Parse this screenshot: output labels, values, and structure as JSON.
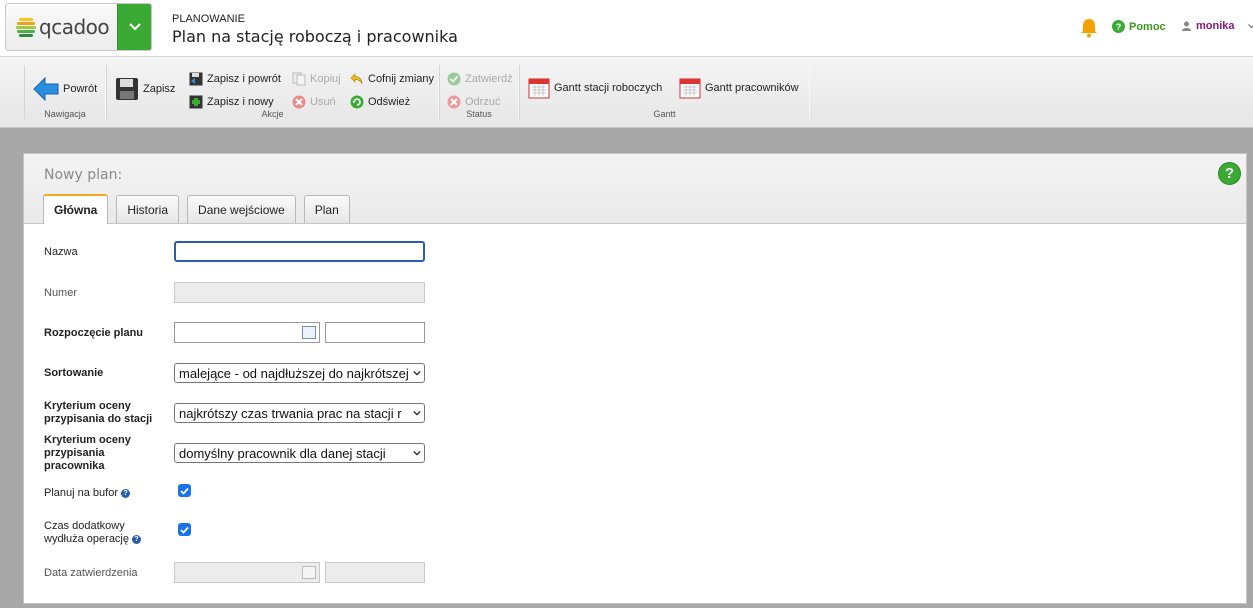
{
  "app": {
    "logo_text": "qcadoo",
    "section": "PLANOWANIE",
    "title": "Plan na stację roboczą i pracownika"
  },
  "topbar": {
    "help_label": "Pomoc",
    "user_name": "monika"
  },
  "toolbar": {
    "groups": {
      "nav": "Nawigacja",
      "actions": "Akcje",
      "status": "Status",
      "gantt": "Gantt"
    },
    "back": "Powrót",
    "save": "Zapisz",
    "save_back": "Zapisz i powrót",
    "save_new": "Zapisz i nowy",
    "copy": "Kopiuj",
    "delete": "Usuń",
    "undo": "Cofnij zmiany",
    "refresh": "Odśwież",
    "approve": "Zatwierdź",
    "reject": "Odrzuć",
    "gantt_stations": "Gantt stacji roboczych",
    "gantt_workers": "Gantt pracowników"
  },
  "form": {
    "title": "Nowy plan:",
    "tabs": [
      "Główna",
      "Historia",
      "Dane wejściowe",
      "Plan"
    ],
    "fields": {
      "name_label": "Nazwa",
      "number_label": "Numer",
      "start_label": "Rozpoczęcie planu",
      "sort_label": "Sortowanie",
      "sort_value": "malejące - od najdłuższej do najkrótszej",
      "station_crit_label": "Kryterium oceny przypisania do stacji",
      "station_crit_value": "najkrótszy czas trwania prac na stacji r",
      "worker_crit_label": "Kryterium oceny przypisania pracownika",
      "worker_crit_value": "domyślny pracownik dla danej stacji",
      "buffer_label": "Planuj na bufor",
      "extra_time_label": "Czas dodatkowy wydłuża operację",
      "approval_date_label": "Data zatwierdzenia"
    }
  },
  "colors": {
    "accent_green": "#3aaa35",
    "tab_accent": "#f5a623",
    "focus_blue": "#2a5db0",
    "checkbox_blue": "#1a73e8"
  }
}
